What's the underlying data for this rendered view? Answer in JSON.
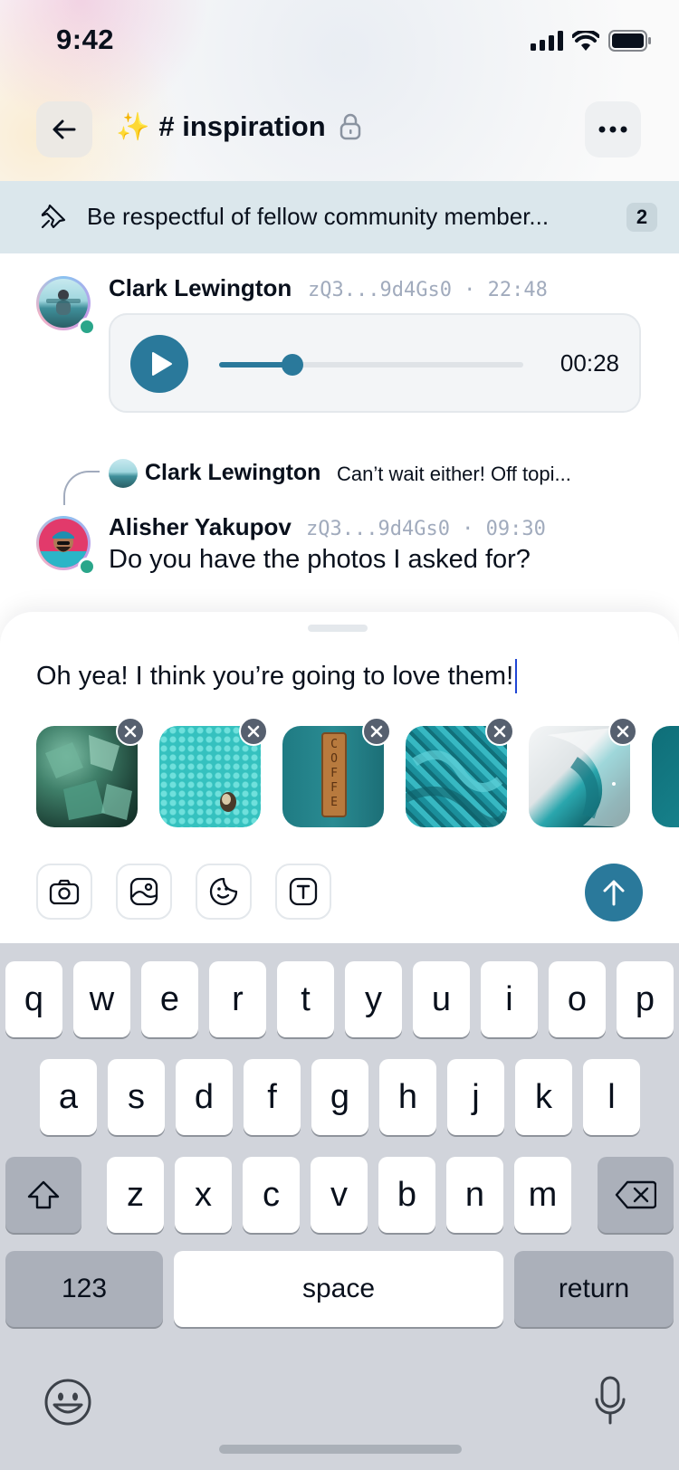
{
  "status_bar": {
    "time": "9:42"
  },
  "header": {
    "back_icon": "arrow-left-icon",
    "sparkle_emoji": "✨",
    "channel_name": "# inspiration",
    "lock_icon": "lock-icon",
    "more_icon": "more-horizontal-icon"
  },
  "pinned": {
    "text": "Be respectful of fellow community member...",
    "count": "2"
  },
  "messages": [
    {
      "author": "Clark Lewington",
      "meta": "zQ3...9d4Gs0 · 22:48",
      "audio": {
        "duration": "00:28",
        "progress": 0.24
      }
    },
    {
      "reply_to": {
        "author": "Clark Lewington",
        "text": "Can’t wait either! Off topi..."
      },
      "author": "Alisher Yakupov",
      "meta": "zQ3...9d4Gs0 · 09:30",
      "text": "Do you have the photos I asked for?"
    }
  ],
  "composer": {
    "text": "Oh yea! I think you’re going to love them!",
    "attachments": [
      {
        "name": "green-crystals"
      },
      {
        "name": "teal-beads"
      },
      {
        "name": "coffee-sign"
      },
      {
        "name": "teal-rope"
      },
      {
        "name": "teal-abstract"
      },
      {
        "name": "teal-partial"
      }
    ],
    "tools": [
      "camera-icon",
      "gallery-icon",
      "sticker-icon",
      "text-format-icon"
    ]
  },
  "keyboard": {
    "row1": [
      "q",
      "w",
      "e",
      "r",
      "t",
      "y",
      "u",
      "i",
      "o",
      "p"
    ],
    "row2": [
      "a",
      "s",
      "d",
      "f",
      "g",
      "h",
      "j",
      "k",
      "l"
    ],
    "row3": [
      "z",
      "x",
      "c",
      "v",
      "b",
      "n",
      "m"
    ],
    "numbers_label": "123",
    "space_label": "space",
    "return_label": "return"
  },
  "colors": {
    "accent": "#2a799b",
    "online": "#2aa68a",
    "pinned_bg": "#dbe7ec",
    "meta": "#a1abbd"
  }
}
